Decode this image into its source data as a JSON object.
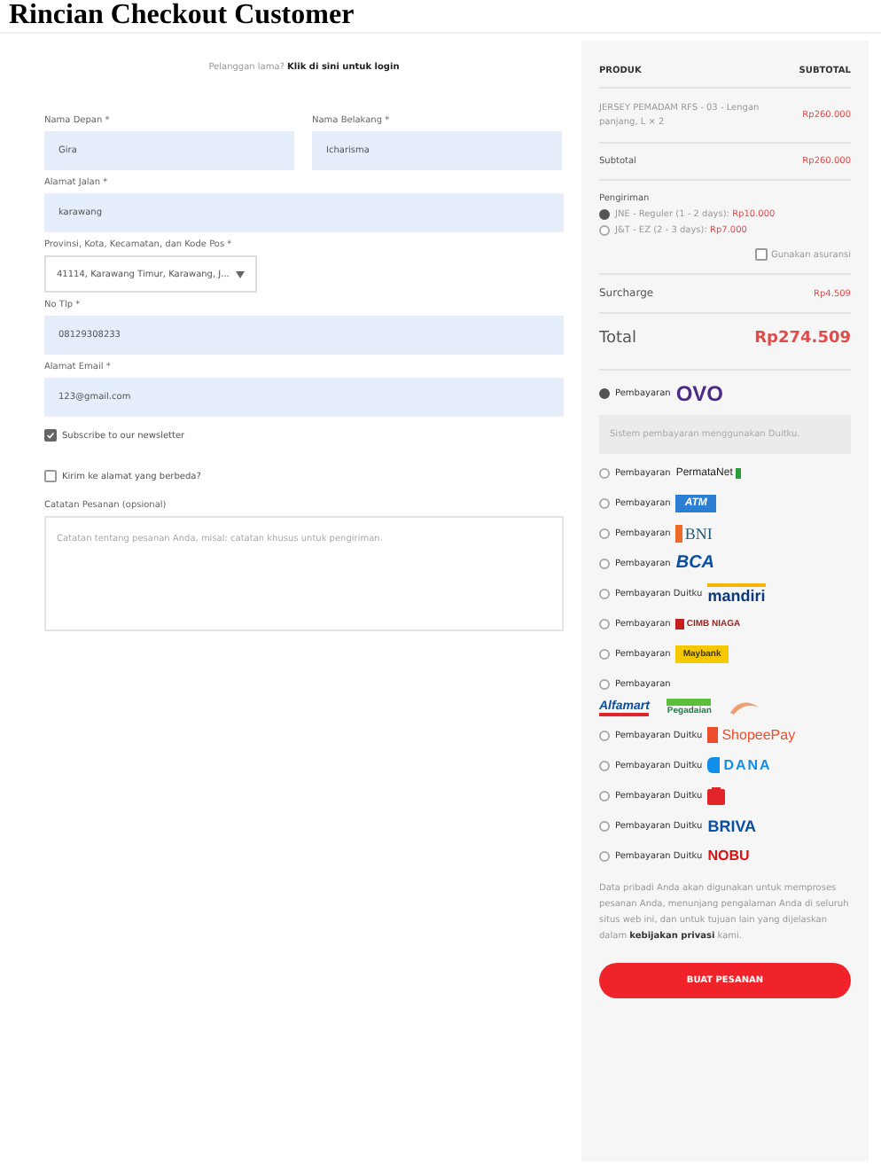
{
  "page_title": "Rincian Checkout Customer",
  "login_prompt": {
    "text": "Pelanggan lama?",
    "link": "Klik di sini untuk login"
  },
  "form": {
    "fields": [
      {
        "kind": "half",
        "label": "Nama Depan *",
        "value": "Gira"
      },
      {
        "kind": "half",
        "label": "Nama Belakang *",
        "value": "Icharisma"
      },
      {
        "kind": "full",
        "label": "Alamat Jalan *",
        "value": "karawang"
      },
      {
        "kind": "select",
        "label": "Provinsi, Kota, Kecamatan, dan Kode Pos *",
        "value": "41114, Karawang Timur, Karawang, J..."
      },
      {
        "kind": "full",
        "label": "No Tlp *",
        "value": "08129308233"
      },
      {
        "kind": "full",
        "label": "Alamat Email *",
        "value": "123@gmail.com"
      }
    ],
    "newsletter": {
      "label": "Subscribe to our newsletter",
      "checked": true
    },
    "ship_different": {
      "label": "Kirim ke alamat yang berbeda?",
      "checked": false
    },
    "notes": {
      "label": "Catatan Pesanan (opsional)",
      "placeholder": "Catatan tentang pesanan Anda, misal: catatan khusus untuk pengiriman."
    }
  },
  "order": {
    "columns": [
      "PRODUK",
      "SUBTOTAL"
    ],
    "product": {
      "name": "JERSEY PEMADAM RFS - 03 - Lengan panjang, L × 2",
      "price": "Rp260.000"
    },
    "subtotal": {
      "label": "Subtotal",
      "value": "Rp260.000"
    },
    "shipping": {
      "label": "Pengiriman",
      "options": [
        {
          "label": "JNE - Reguler (1 - 2 days):",
          "price": "Rp10.000",
          "selected": true
        },
        {
          "label": "J&T - EZ (2 - 3 days):",
          "price": "Rp7.000",
          "selected": false
        }
      ],
      "insurance": {
        "label": "Gunakan asuransi",
        "checked": false
      }
    },
    "surcharge": {
      "label": "Surcharge",
      "value": "Rp4.509"
    },
    "total": {
      "label": "Total",
      "value": "Rp274.509"
    }
  },
  "payments": [
    {
      "label": "Pembayaran",
      "logos": [
        {
          "kind": "ovo",
          "text": "OVO"
        }
      ],
      "selected": true,
      "info": "Sistem pembayaran menggunakan Duitku."
    },
    {
      "label": "Pembayaran",
      "logos": [
        {
          "kind": "permata",
          "text": "PermataNet"
        }
      ],
      "selected": false
    },
    {
      "label": "Pembayaran",
      "logos": [
        {
          "kind": "atm",
          "text": "ATM"
        }
      ],
      "selected": false
    },
    {
      "label": "Pembayaran",
      "logos": [
        {
          "kind": "bni",
          "text": "BNI"
        }
      ],
      "selected": false
    },
    {
      "label": "Pembayaran",
      "logos": [
        {
          "kind": "bca",
          "text": "BCA"
        }
      ],
      "selected": false
    },
    {
      "label": "Pembayaran Duitku",
      "logos": [
        {
          "kind": "mandiri",
          "text": "mandiri"
        }
      ],
      "selected": false
    },
    {
      "label": "Pembayaran",
      "logos": [
        {
          "kind": "cimb",
          "text": "CIMB NIAGA"
        }
      ],
      "selected": false
    },
    {
      "label": "Pembayaran",
      "logos": [
        {
          "kind": "maybank",
          "text": "Maybank"
        }
      ],
      "selected": false
    },
    {
      "label": "Pembayaran",
      "logos": [
        {
          "kind": "alfamart",
          "text": "Alfamart"
        },
        {
          "kind": "pegadaian",
          "text": "Pegadaian"
        },
        {
          "kind": "pos"
        }
      ],
      "selected": false
    },
    {
      "label": "Pembayaran Duitku",
      "logos": [
        {
          "kind": "shopeepay",
          "text": "ShopeePay"
        }
      ],
      "selected": false
    },
    {
      "label": "Pembayaran Duitku",
      "logos": [
        {
          "kind": "dana",
          "text": "DANA"
        }
      ],
      "selected": false
    },
    {
      "label": "Pembayaran Duitku",
      "logos": [
        {
          "kind": "redbag"
        }
      ],
      "selected": false
    },
    {
      "label": "Pembayaran Duitku",
      "logos": [
        {
          "kind": "briva",
          "text": "BRIVA"
        }
      ],
      "selected": false
    },
    {
      "label": "Pembayaran Duitku",
      "logos": [
        {
          "kind": "nobu",
          "text": "NOBU"
        }
      ],
      "selected": false
    }
  ],
  "privacy": "Data pribadi Anda akan digunakan untuk memproses pesanan Anda, menunjang pengalaman Anda di seluruh situs web ini, dan untuk tujuan lain yang dijelaskan dalam **kebijakan privasi** kami.",
  "place_order": "BUAT PESANAN"
}
